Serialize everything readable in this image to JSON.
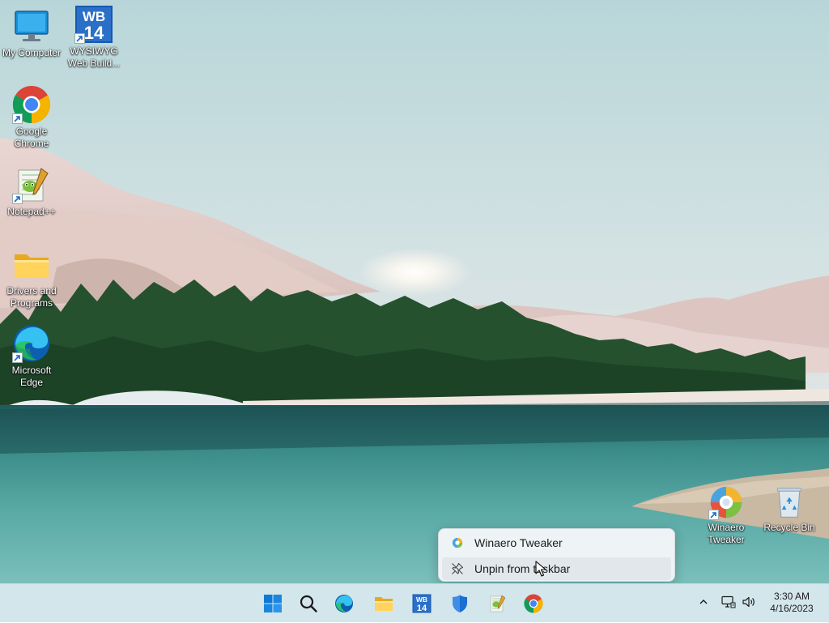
{
  "desktop": {
    "icons": [
      {
        "label": "My Computer",
        "icon": "computer-monitor-icon"
      },
      {
        "label": "WYSIWYG Web Build...",
        "icon": "wysiwyg-web-builder-icon",
        "badge": "WB",
        "badge_number": "14"
      },
      {
        "label": "Google Chrome",
        "icon": "chrome-icon"
      },
      {
        "label": "Notepad++",
        "icon": "notepad-plus-plus-icon"
      },
      {
        "label": "Drivers and Programs",
        "icon": "folder-icon"
      },
      {
        "label": "Microsoft Edge",
        "icon": "edge-icon"
      },
      {
        "label": "Winaero Tweaker",
        "icon": "winaero-tweaker-icon"
      },
      {
        "label": "Recycle Bin",
        "icon": "recycle-bin-icon"
      }
    ]
  },
  "context_menu": {
    "items": [
      {
        "label": "Winaero Tweaker",
        "icon": "winaero-tweaker-icon"
      },
      {
        "label": "Unpin from taskbar",
        "icon": "unpin-icon"
      }
    ]
  },
  "taskbar": {
    "buttons": [
      {
        "name": "start",
        "icon": "windows-logo-icon"
      },
      {
        "name": "search",
        "icon": "search-icon"
      },
      {
        "name": "edge",
        "icon": "edge-icon"
      },
      {
        "name": "file-explorer",
        "icon": "folder-icon"
      },
      {
        "name": "wysiwyg-web-builder",
        "icon": "wysiwyg-web-builder-icon"
      },
      {
        "name": "windows-security",
        "icon": "shield-icon"
      },
      {
        "name": "notepad-plus-plus",
        "icon": "notepad-plus-plus-icon"
      },
      {
        "name": "chrome",
        "icon": "chrome-icon"
      }
    ],
    "tray": {
      "icons": [
        "chevron-up-icon",
        "network-icon",
        "volume-icon"
      ],
      "time": "3:30 AM",
      "date": "4/16/2023"
    }
  },
  "colors": {
    "taskbar_bg": "#d3e6ec",
    "menu_bg": "#eef3f6",
    "windows_blue": "#0078d4"
  }
}
